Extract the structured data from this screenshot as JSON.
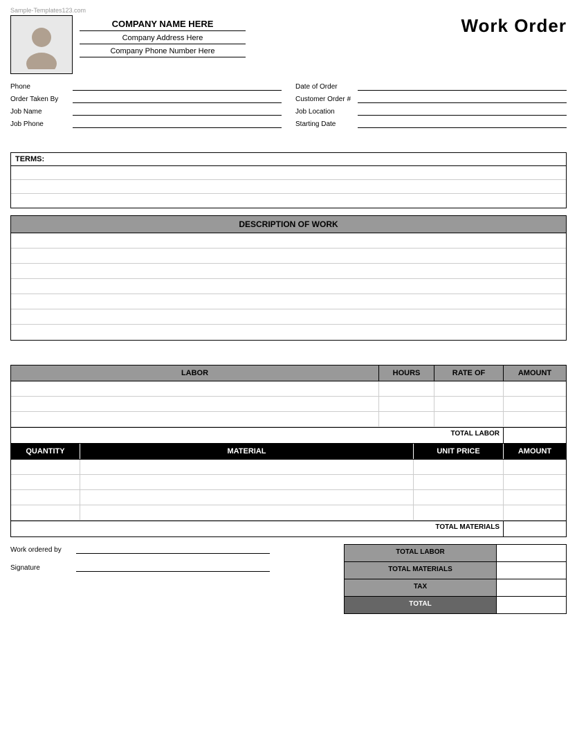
{
  "watermark": "Sample-Templates123.com",
  "header": {
    "company_name": "COMPANY NAME HERE",
    "company_address": "Company Address Here",
    "company_phone": "Company Phone Number Here",
    "title": "Work Order"
  },
  "form": {
    "left": [
      {
        "label": "Phone",
        "id": "phone"
      },
      {
        "label": "Order Taken By",
        "id": "order-taken-by"
      },
      {
        "label": "Job Name",
        "id": "job-name"
      },
      {
        "label": "Job Phone",
        "id": "job-phone"
      }
    ],
    "right": [
      {
        "label": "Date of Order",
        "id": "date-of-order"
      },
      {
        "label": "Customer Order #",
        "id": "customer-order"
      },
      {
        "label": "Job Location",
        "id": "job-location"
      },
      {
        "label": "Starting Date",
        "id": "starting-date"
      }
    ]
  },
  "terms": {
    "header": "TERMS:",
    "rows": 3
  },
  "description": {
    "header": "DESCRIPTION OF WORK",
    "rows": 7
  },
  "labor": {
    "columns": [
      "LABOR",
      "HOURS",
      "RATE OF",
      "AMOUNT"
    ],
    "rows": 3,
    "total_label": "TOTAL LABOR"
  },
  "materials": {
    "columns": [
      "QUANTITY",
      "MATERIAL",
      "UNIT PRICE",
      "AMOUNT"
    ],
    "rows": 4,
    "total_label": "TOTAL MATERIALS"
  },
  "summary": {
    "work_ordered_label": "Work ordered by",
    "signature_label": "Signature",
    "totals": [
      {
        "label": "TOTAL LABOR",
        "dark": false
      },
      {
        "label": "TOTAL MATERIALS",
        "dark": false
      },
      {
        "label": "TAX",
        "dark": false
      },
      {
        "label": "TOTAL",
        "dark": true
      }
    ]
  }
}
